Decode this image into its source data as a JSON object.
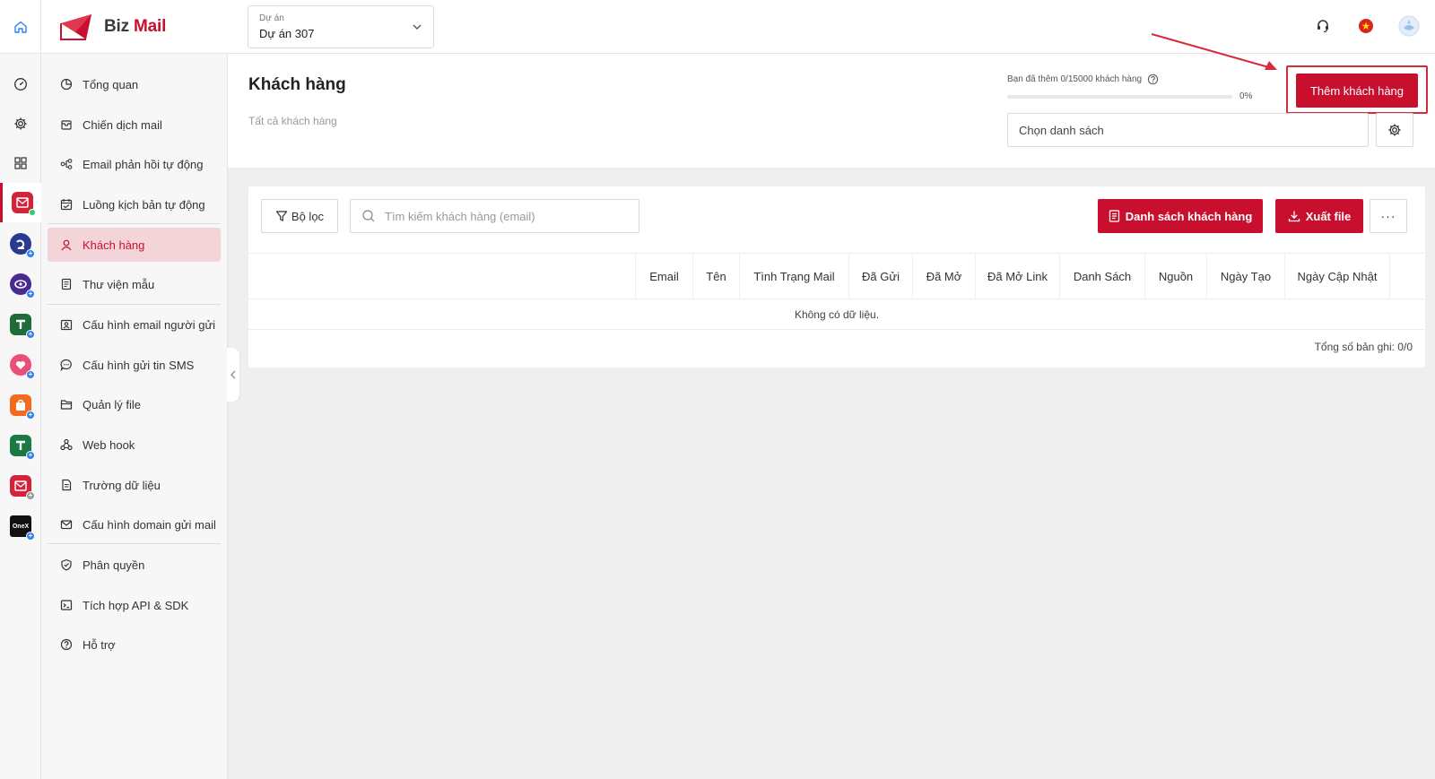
{
  "header": {
    "logo_prefix": "Biz",
    "logo_suffix": "Mail",
    "project_label": "Dự án",
    "project_value": "Dự án 307"
  },
  "rail": {
    "items": [
      "dashboard-icon",
      "settings-icon",
      "apps-grid-icon",
      "bizmail-app-icon",
      "app-2-icon",
      "app-3-icon",
      "app-4-icon",
      "app-5-icon",
      "app-6-icon",
      "app-7-icon",
      "app-8-icon",
      "onex-app-icon"
    ],
    "onex_text": "OneX"
  },
  "sidebar": {
    "items": [
      {
        "label": "Tổng quan"
      },
      {
        "label": "Chiến dịch mail"
      },
      {
        "label": "Email phản hồi tự động"
      },
      {
        "label": "Luồng kịch bản tự động"
      },
      {
        "label": "Khách hàng"
      },
      {
        "label": "Thư viện mẫu"
      },
      {
        "label": "Cấu hình email người gửi"
      },
      {
        "label": "Cấu hình gửi tin SMS"
      },
      {
        "label": "Quản lý file"
      },
      {
        "label": "Web hook"
      },
      {
        "label": "Trường dữ liệu"
      },
      {
        "label": "Cấu hình domain gửi mail"
      },
      {
        "label": "Phân quyền"
      },
      {
        "label": "Tích hợp API & SDK"
      },
      {
        "label": "Hỗ trợ"
      }
    ],
    "active_index": 4
  },
  "page": {
    "title": "Khách hàng",
    "subtitle": "Tất cả khách hàng",
    "quota_text": "Bạn đã thêm 0/15000 khách hàng",
    "progress_value": 0,
    "progress_label": "0%",
    "add_button": "Thêm khách hàng",
    "list_select_placeholder": "Chọn danh sách"
  },
  "toolbar": {
    "filter_label": "Bộ lọc",
    "search_placeholder": "Tìm kiếm khách hàng (email)",
    "customer_list_button": "Danh sách khách hàng",
    "export_button": "Xuất file",
    "more_label": "···"
  },
  "table": {
    "columns": [
      "Email",
      "Tên",
      "Tình Trạng Mail",
      "Đã Gửi",
      "Đã Mở",
      "Đã Mở Link",
      "Danh Sách",
      "Nguồn",
      "Ngày Tạo",
      "Ngày Cập Nhật"
    ],
    "empty_text": "Không có dữ liệu.",
    "total_text": "Tổng số bản ghi: 0/0"
  },
  "colors": {
    "brand": "#c8102e",
    "active_bg": "#f3d4d8",
    "annotation": "#d62b3a"
  }
}
